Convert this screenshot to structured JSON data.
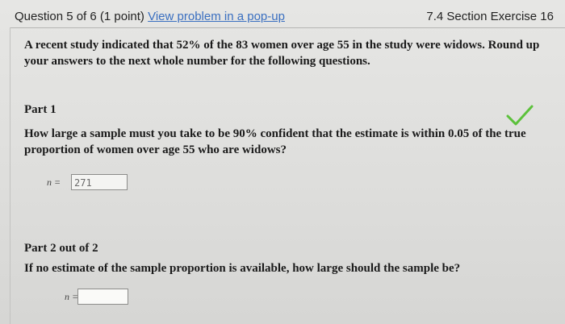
{
  "header": {
    "question_label": "Question 5 of 6 (1 point)",
    "popup_link": "View problem in a pop-up",
    "section": "7.4 Section Exercise 16"
  },
  "intro": "A recent study indicated that 52% of the 83 women over age 55 in the study were widows. Round up your answers to the next whole number for the following questions.",
  "part1": {
    "title": "Part 1",
    "question": "How large a sample must you take to be 90% confident that the estimate is within 0.05 of the true proportion of women over age 55 who are widows?",
    "label": "n =",
    "answer": "271",
    "status_icon": "checkmark-icon",
    "status_color": "#5cc13b"
  },
  "part2": {
    "title": "Part 2 out of 2",
    "question": "If no estimate of the sample proportion is available, how large should the sample be?",
    "label": "n =",
    "answer": ""
  }
}
